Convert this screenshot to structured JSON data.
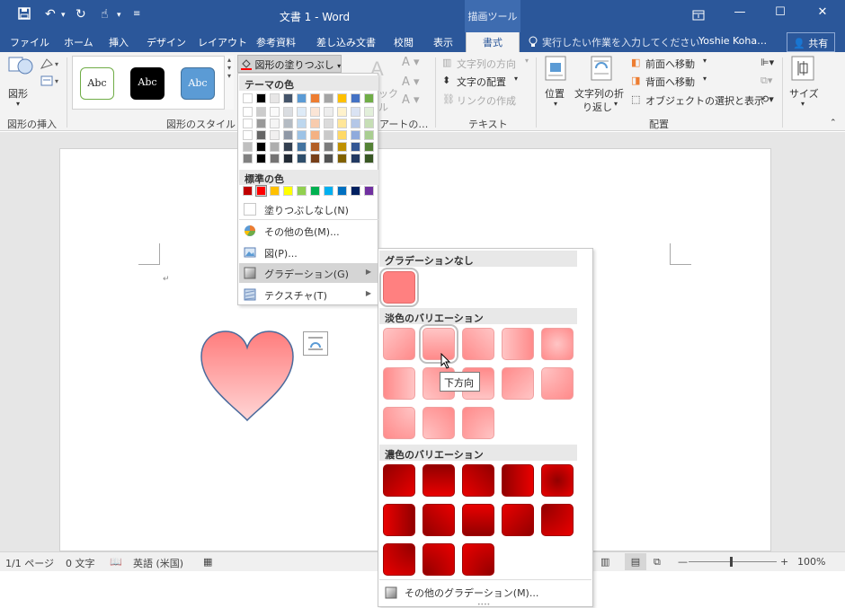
{
  "window": {
    "title": "文書 1 - Word",
    "context_tab_group": "描画ツール"
  },
  "tabs": [
    "ファイル",
    "ホーム",
    "挿入",
    "デザイン",
    "レイアウト",
    "参考資料",
    "差し込み文書",
    "校閲",
    "表示"
  ],
  "active_tab": "書式",
  "tell_me": "実行したい作業を入力してください",
  "user_name": "Yoshie Koha…",
  "share_label": "共有",
  "ribbon": {
    "insert_shapes": {
      "shape_label": "図形",
      "group_label": "図形の挿入"
    },
    "shape_styles": {
      "group_label": "図形のスタイル",
      "swatch_text": "Abc",
      "fill_button_label": "図形の塗りつぶし"
    },
    "wordart": {
      "group_label": "アートの…",
      "partial_label_1": "ック",
      "partial_label_2": "ル"
    },
    "text": {
      "group_label": "テキスト",
      "direction_label": "文字列の方向",
      "align_label": "文字の配置",
      "link_label": "リンクの作成"
    },
    "arrange": {
      "group_label": "配置",
      "position_label": "位置",
      "wrap_label_1": "文字列の折",
      "wrap_label_2": "り返し",
      "bring_forward_label": "前面へ移動",
      "send_backward_label": "背面へ移動",
      "selection_pane_label": "オブジェクトの選択と表示"
    },
    "size": {
      "label": "サイズ"
    }
  },
  "fill_menu": {
    "theme_colors_header": "テーマの色",
    "standard_colors_header": "標準の色",
    "no_fill": "塗りつぶしなし(N)",
    "more_colors": "その他の色(M)...",
    "picture": "図(P)...",
    "gradient": "グラデーション(G)",
    "texture": "テクスチャ(T)"
  },
  "gradient_menu": {
    "no_gradient_header": "グラデーションなし",
    "light_variations_header": "淡色のバリエーション",
    "dark_variations_header": "濃色のバリエーション",
    "more_gradients": "その他のグラデーション(M)...",
    "tooltip": "下方向"
  },
  "status": {
    "page": "1/1 ページ",
    "words": "0 文字",
    "language": "英語 (米国)",
    "zoom": "100%"
  },
  "colors": {
    "title_bar": "#2b579a",
    "theme_row_1": [
      "#ffffff",
      "#000000",
      "#e7e6e6",
      "#44546a",
      "#5b9bd5",
      "#ed7d31",
      "#a5a5a5",
      "#ffc000",
      "#4472c4",
      "#70ad47"
    ],
    "standard": [
      "#c00000",
      "#ff0000",
      "#ffc000",
      "#ffff00",
      "#92d050",
      "#00b050",
      "#00b0f0",
      "#0070c0",
      "#002060",
      "#7030a0"
    ],
    "light_gradient_base": "#ff8a8a",
    "dark_gradient_base": "#e00000"
  }
}
